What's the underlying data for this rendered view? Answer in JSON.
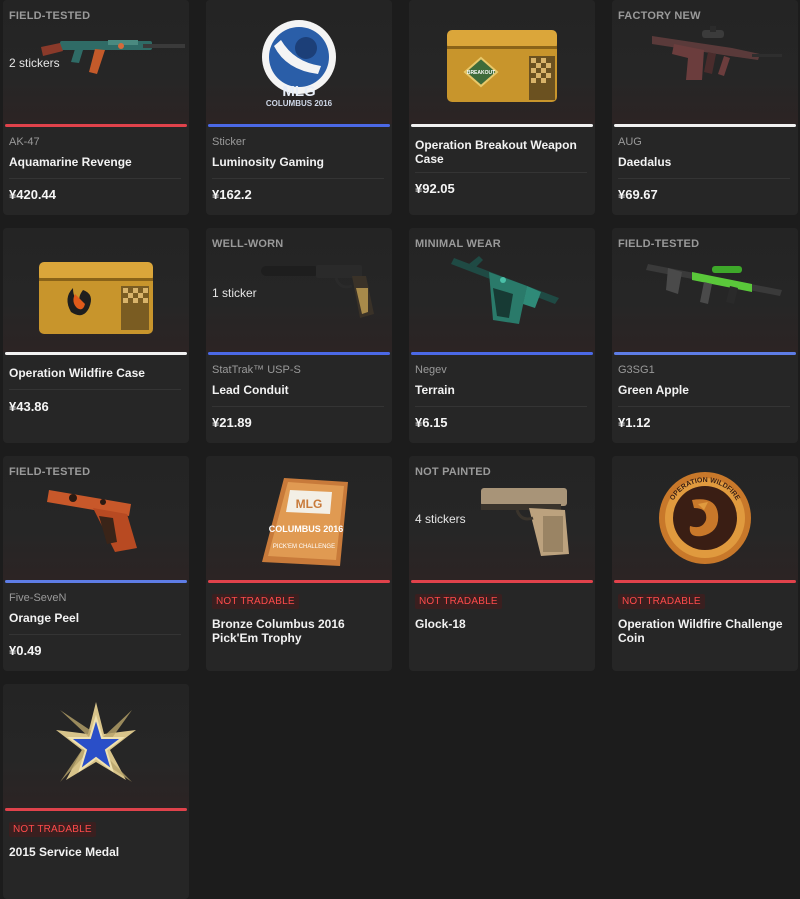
{
  "items": [
    {
      "wear": "FIELD-TESTED",
      "stickers": "2 stickers",
      "type": "AK-47",
      "name": "Aquamarine Revenge",
      "price": "¥420.44",
      "rarity": "#e0424b",
      "icon": "rifle-icon"
    },
    {
      "wear": "",
      "stickers": "",
      "type": "Sticker",
      "name": "Luminosity Gaming",
      "price": "¥162.2",
      "rarity": "#4b69e6",
      "icon": "sticker-icon"
    },
    {
      "wear": "",
      "stickers": "",
      "type": "",
      "name": "Operation Breakout Weapon Case",
      "price": "¥92.05",
      "rarity": "#f2f2f2",
      "icon": "case-icon"
    },
    {
      "wear": "FACTORY NEW",
      "stickers": "",
      "type": "AUG",
      "name": "Daedalus",
      "price": "¥69.67",
      "rarity": "#f2f2f2",
      "icon": "rifle-icon"
    },
    {
      "wear": "",
      "stickers": "",
      "type": "",
      "name": "Operation Wildfire Case",
      "price": "¥43.86",
      "rarity": "#f2f2f2",
      "icon": "case-icon"
    },
    {
      "wear": "WELL-WORN",
      "stickers": "1 sticker",
      "type": "StatTrak™ USP-S",
      "name": "Lead Conduit",
      "price": "¥21.89",
      "rarity": "#4b69e6",
      "icon": "pistol-icon"
    },
    {
      "wear": "MINIMAL WEAR",
      "stickers": "",
      "type": "Negev",
      "name": "Terrain",
      "price": "¥6.15",
      "rarity": "#4b69e6",
      "icon": "machinegun-icon"
    },
    {
      "wear": "FIELD-TESTED",
      "stickers": "",
      "type": "G3SG1",
      "name": "Green Apple",
      "price": "¥1.12",
      "rarity": "#5e7de6",
      "icon": "sniper-icon"
    },
    {
      "wear": "FIELD-TESTED",
      "stickers": "",
      "type": "Five-SeveN",
      "name": "Orange Peel",
      "price": "¥0.49",
      "rarity": "#5e7de6",
      "icon": "pistol-icon"
    },
    {
      "wear": "",
      "stickers": "",
      "type": "",
      "badge": "NOT TRADABLE",
      "name": "Bronze Columbus 2016 Pick'Em Trophy",
      "price": "",
      "rarity": "#e0424b",
      "icon": "trophy-icon"
    },
    {
      "wear": "NOT PAINTED",
      "stickers": "4 stickers",
      "type": "",
      "badge": "NOT TRADABLE",
      "name": "Glock-18",
      "price": "",
      "rarity": "#e0424b",
      "icon": "pistol-icon"
    },
    {
      "wear": "",
      "stickers": "",
      "type": "",
      "badge": "NOT TRADABLE",
      "name": "Operation Wildfire Challenge Coin",
      "price": "",
      "rarity": "#e0424b",
      "icon": "coin-icon"
    },
    {
      "wear": "",
      "stickers": "",
      "type": "",
      "badge": "NOT TRADABLE",
      "name": "2015 Service Medal",
      "price": "",
      "rarity": "#e0424b",
      "icon": "medal-icon"
    }
  ],
  "artwork_text": {
    "sticker_logo": "MLG",
    "sticker_event": "COLUMBUS 2016",
    "case_label": "BREAKOUT",
    "trophy_logo": "MLG",
    "trophy_event": "COLUMBUS 2016",
    "trophy_sub": "PICK'EM CHALLENGE",
    "coin_text": "OPERATION WILDFIRE"
  }
}
